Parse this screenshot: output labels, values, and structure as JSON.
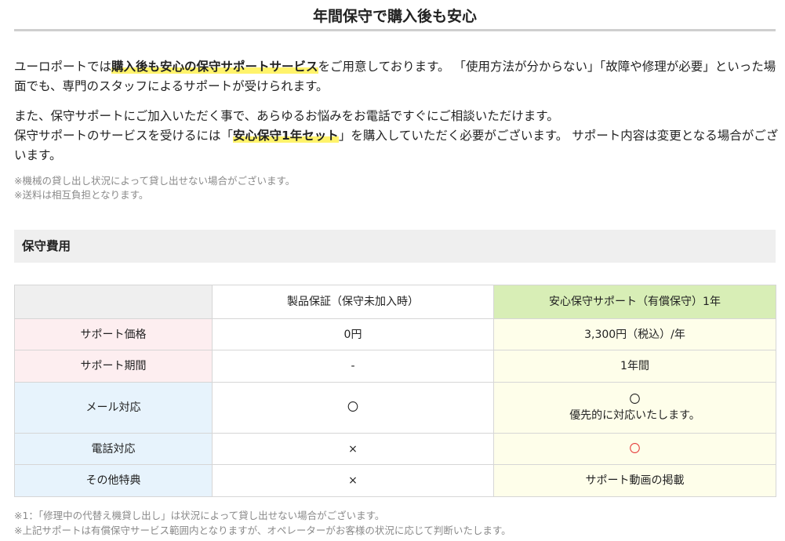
{
  "title": "年間保守で購入後も安心",
  "intro": {
    "p1_a": "ユーロポートでは",
    "p1_hl": "購入後も安心の保守サポートサービス",
    "p1_b": "をご用意しております。 「使用方法が分からない」「故障や修理が必要」といった場面でも、専門のスタッフによるサポートが受けられます。",
    "p2_a": "また、保守サポートにご加入いただく事で、あらゆるお悩みをお電話ですぐにご相談いただけます。",
    "p2_b": "保守サポートのサービスを受けるには「",
    "p2_hl": "安心保守1年セット",
    "p2_c": "」を購入していただく必要がございます。 サポート内容は変更となる場合がございます。"
  },
  "notes": [
    "※機械の貸し出し状況によって貸し出せない場合がございます。",
    "※送料は相互負担となります。"
  ],
  "section_heading": "保守費用",
  "table": {
    "headers": [
      "",
      "製品保証（保守未加入時）",
      "安心保守サポート（有償保守）1年"
    ],
    "rows": [
      {
        "label": "サポート価格",
        "basic": "0円",
        "plus": "3,300円（税込）/年"
      },
      {
        "label": "サポート期間",
        "basic": "-",
        "plus": "1年間"
      },
      {
        "label": "メール対応",
        "basic": "〇",
        "plus": "〇",
        "plus_sub": "優先的に対応いたします。"
      },
      {
        "label": "電話対応",
        "basic": "×",
        "plus": "〇"
      },
      {
        "label": "その他特典",
        "basic": "×",
        "plus": "サポート動画の掲載"
      }
    ]
  },
  "footnotes": [
    "※1：「修理中の代替え機貸し出し」は状況によって貸し出せない場合がございます。",
    "※上記サポートは有償保守サービス範囲内となりますが、オペレーターがお客様の状況に応じて判断いたします。"
  ],
  "colors": {
    "highlight": "#fff36b",
    "plus_header": "#d8eeb6",
    "plus_cell": "#fefeea",
    "label_pink": "#fdeef0",
    "label_blue": "#e7f3fc",
    "accent_red": "#e53a3a"
  }
}
